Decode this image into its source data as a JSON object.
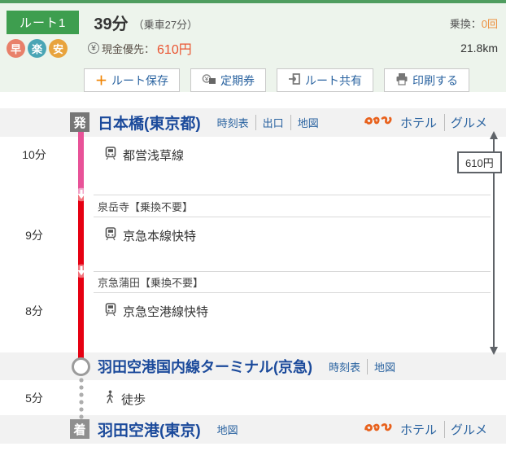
{
  "header": {
    "route_badge": "ルート1",
    "duration": "39分",
    "ride_time": "（乗車27分）",
    "transfer_label": "乗換：",
    "transfer_count": "0回",
    "tags": [
      {
        "label": "早",
        "color": "#e8806a"
      },
      {
        "label": "楽",
        "color": "#4aa5b5"
      },
      {
        "label": "安",
        "color": "#e8a33d"
      }
    ],
    "yen_icon": "¥",
    "fare_label": "現金優先：",
    "fare_value": "610円",
    "distance": "21.8km",
    "buttons": [
      {
        "label": "ルート保存",
        "icon": "plus-icon",
        "icon_char": "＋"
      },
      {
        "label": "定期券",
        "icon": "commuter-pass-icon"
      },
      {
        "label": "ルート共有",
        "icon": "share-icon"
      },
      {
        "label": "印刷する",
        "icon": "printer-icon"
      }
    ]
  },
  "route": {
    "fare_tag": "610円",
    "departure": {
      "badge": "発",
      "name": "日本橋(東京都)",
      "links": [
        "時刻表",
        "出口",
        "地図"
      ],
      "promo": [
        "ホテル",
        "グルメ"
      ]
    },
    "segments": [
      {
        "duration": "10分",
        "line": "都営浅草線",
        "color": "#e85298"
      },
      {
        "duration": "9分",
        "line": "京急本線快特",
        "color": "#e60012"
      },
      {
        "duration": "8分",
        "line": "京急空港線快特",
        "color": "#e60012"
      },
      {
        "duration": "5分",
        "line": "徒歩",
        "mode": "walk"
      }
    ],
    "transfers": [
      {
        "station": "泉岳寺",
        "note": "【乗換不要】"
      },
      {
        "station": "京急蒲田",
        "note": "【乗換不要】"
      }
    ],
    "via_station": {
      "name": "羽田空港国内線ターミナル(京急)",
      "links": [
        "時刻表",
        "地図"
      ]
    },
    "arrival": {
      "badge": "着",
      "name": "羽田空港(東京)",
      "links": [
        "地図"
      ],
      "promo": [
        "ホテル",
        "グルメ"
      ]
    },
    "colors": {
      "toei_asakusa": "#e85298",
      "keikyu": "#e60012"
    }
  }
}
